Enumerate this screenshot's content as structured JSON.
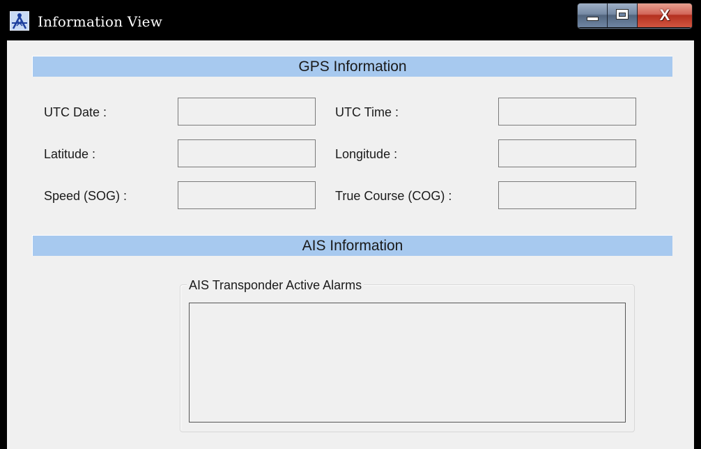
{
  "window": {
    "title": "Information View",
    "icon": "compass-app-icon",
    "close_label": "X"
  },
  "gps": {
    "header": "GPS Information",
    "fields": [
      {
        "label": "UTC Date :",
        "value": ""
      },
      {
        "label": "UTC Time :",
        "value": ""
      },
      {
        "label": "Latitude :",
        "value": ""
      },
      {
        "label": "Longitude :",
        "value": ""
      },
      {
        "label": "Speed (SOG) :",
        "value": ""
      },
      {
        "label": "True Course (COG) :",
        "value": ""
      }
    ]
  },
  "ais": {
    "header": "AIS Information",
    "alarms_group_label": "AIS Transponder Active Alarms",
    "alarms": []
  },
  "colors": {
    "section_header_bg": "#a7c9ef",
    "window_bg": "#f0f0f0",
    "titlebar_bg": "#000000"
  }
}
